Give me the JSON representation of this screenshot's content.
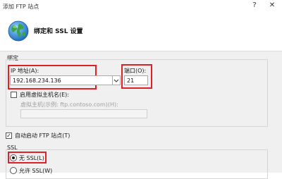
{
  "window": {
    "title": "添加 FTP 站点",
    "help_glyph": "?",
    "close_glyph": "✕"
  },
  "header": {
    "title": "绑定和 SSL 设置",
    "icon": "globe-icon"
  },
  "binding": {
    "group_label": "绑定",
    "ip_label": "IP 地址(A):",
    "ip_value": "192.168.234.136",
    "port_label": "端口(O):",
    "port_value": "21",
    "virtual_host_checkbox_label": "启用虚拟主机名(E):",
    "virtual_host_checked": false,
    "virtual_host_label": "虚拟主机(示例: ftp.contoso.com)(H):",
    "virtual_host_value": ""
  },
  "auto_start": {
    "label": "自动启动 FTP 站点(T)",
    "checked": true
  },
  "ssl": {
    "group_label": "SSL",
    "options": [
      {
        "label": "无 SSL(L)",
        "selected": true
      },
      {
        "label": "允许 SSL(W)",
        "selected": false
      }
    ]
  },
  "colors": {
    "highlight": "#e01f26",
    "dialog_bg": "#f0f0f0"
  }
}
